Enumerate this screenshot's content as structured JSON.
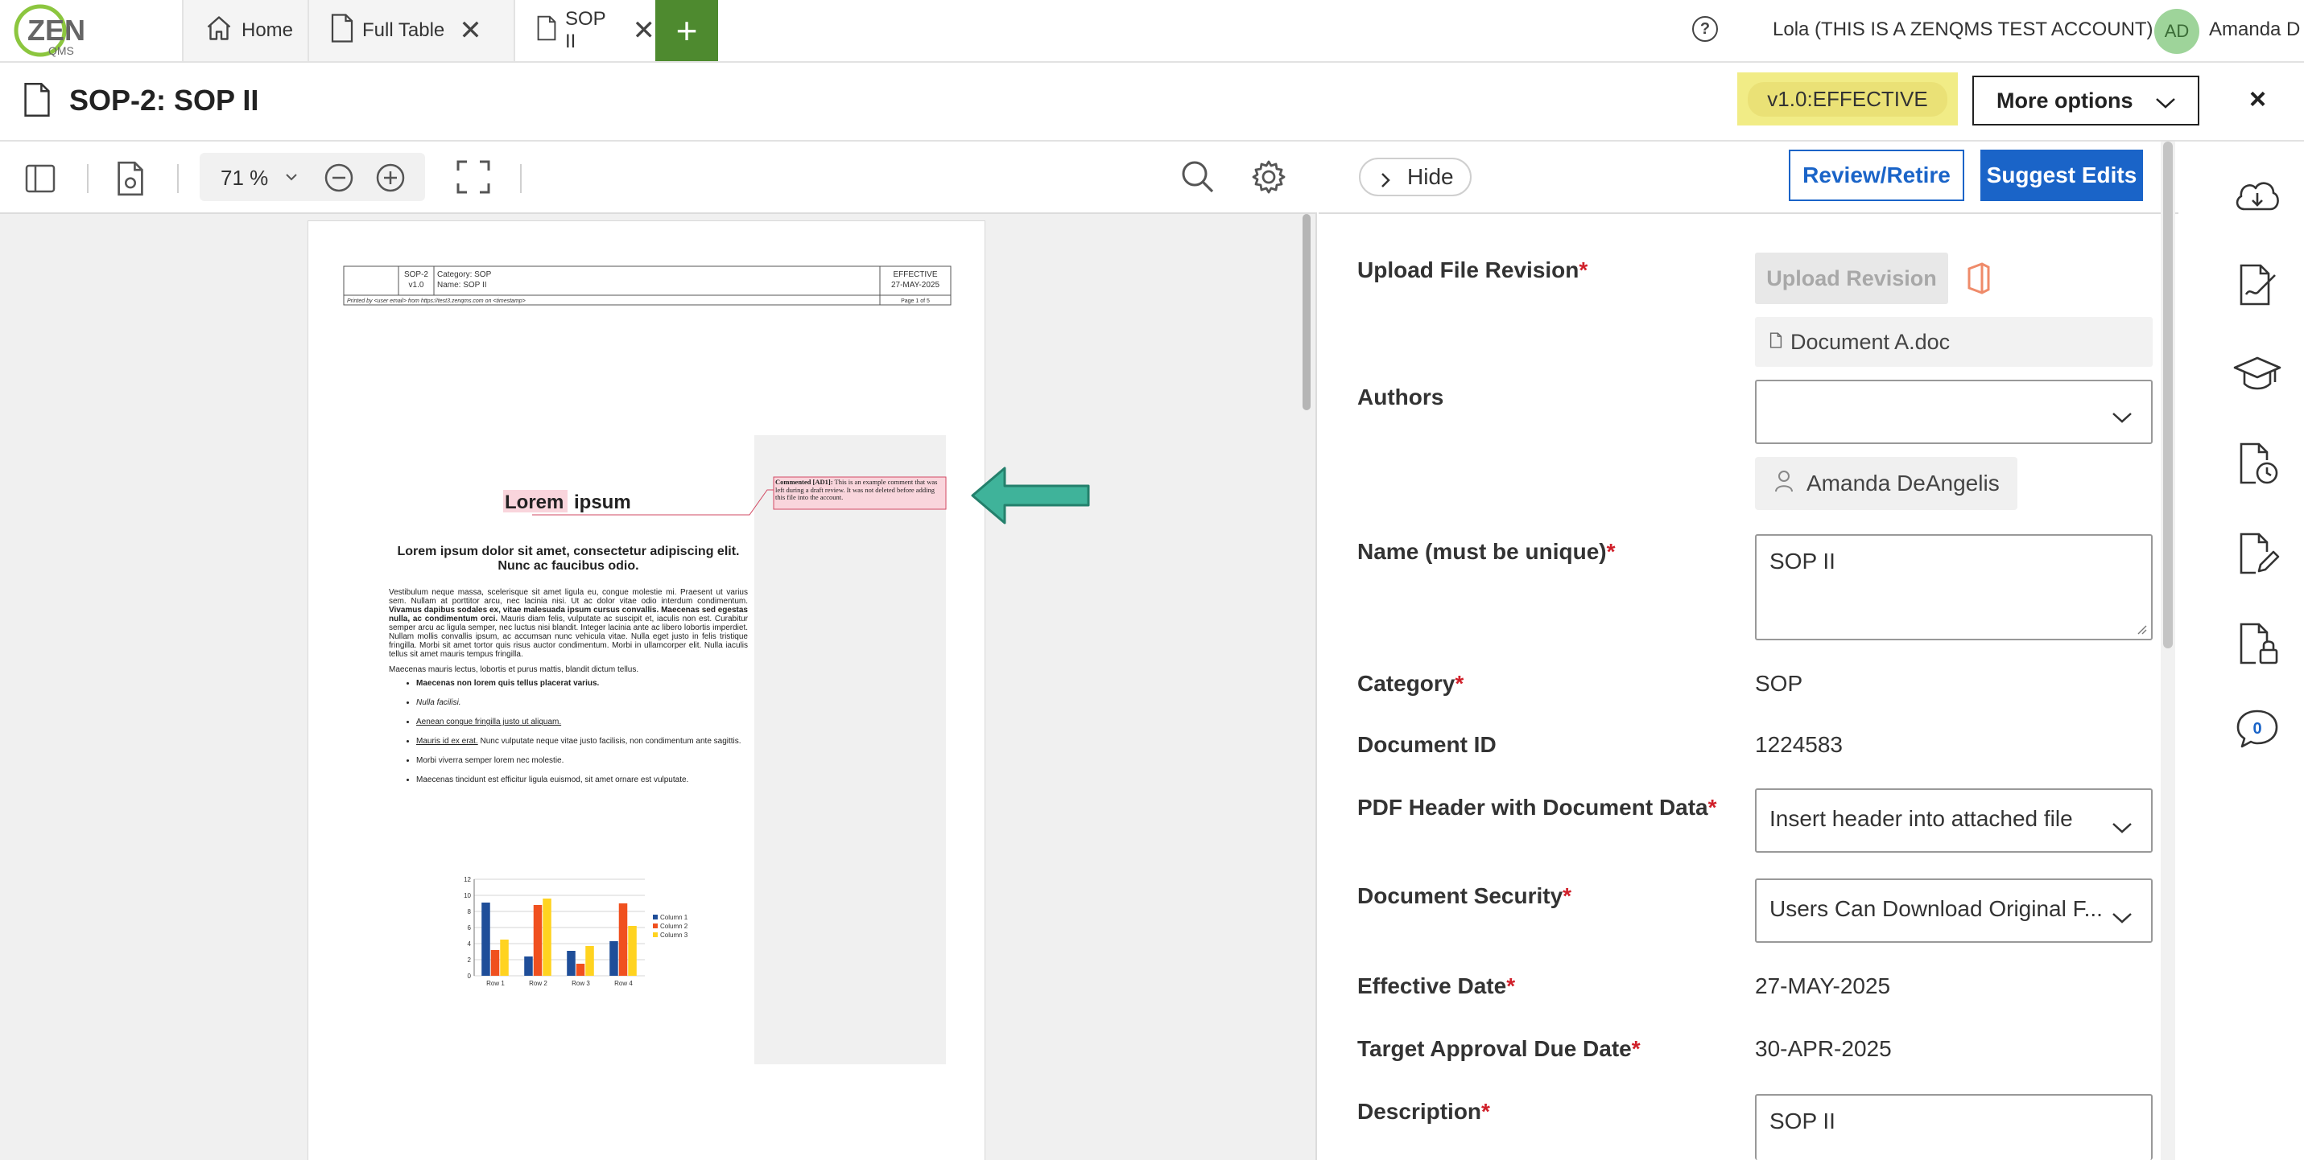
{
  "topbar": {
    "tabs": [
      {
        "label": "Home",
        "icon": "home-icon"
      },
      {
        "label": "Full Table",
        "icon": "document-icon"
      },
      {
        "label": "SOP II",
        "icon": "document-icon",
        "active": true
      }
    ],
    "add_tab_label": "+",
    "help_label": "?",
    "account_label": "Lola (THIS IS A ZENQMS TEST ACCOUNT)",
    "avatar_initials": "AD",
    "user_name": "Amanda D"
  },
  "logo": {
    "text": "ZEN",
    "subtext": "QMS"
  },
  "doc_header": {
    "title": "SOP-2: SOP II",
    "status": "v1.0:EFFECTIVE",
    "more_options_label": "More options",
    "close_label": "×"
  },
  "viewer_toolbar": {
    "zoom": "71 %"
  },
  "pdf": {
    "header": {
      "doc_id": "SOP-2",
      "version": "v1.0",
      "category": "Category: SOP",
      "name": "Name: SOP II",
      "status": "EFFECTIVE",
      "date": "27-MAY-2025",
      "printed_by": "Printed by <user email> from https://test3.zenqms.com on <timestamp>",
      "page": "Page 1 of 5"
    },
    "heading_word1": "Lorem",
    "heading_word2": "ipsum",
    "comment_label": "Commented [AD1]:",
    "comment_text": "This is an example comment that was left during a draft review. It was not deleted before adding this file into the account.",
    "subheading": "Lorem ipsum dolor sit amet, consectetur adipiscing elit. Nunc ac faucibus odio.",
    "paragraph1_a": "Vestibulum neque massa, scelerisque sit amet ligula eu, congue molestie mi. Praesent ut varius sem. Nullam at porttitor arcu, nec lacinia nisi. Ut ac dolor vitae odio interdum condimentum.",
    "paragraph1_b": "Vivamus dapibus sodales ex, vitae malesuada ipsum cursus convallis. Maecenas sed egestas nulla, ac condimentum orci.",
    "paragraph1_c": "Mauris diam felis, vulputate ac suscipit et, iaculis non est. Curabitur semper arcu ac ligula semper, nec luctus nisi blandit. Integer lacinia ante ac libero lobortis imperdiet. Nullam mollis convallis ipsum, ac accumsan nunc vehicula vitae. Nulla eget justo in felis tristique fringilla. Morbi sit amet tortor quis risus auctor condimentum. Morbi in ullamcorper elit. Nulla iaculis tellus sit amet mauris tempus fringilla.",
    "paragraph2": "Maecenas mauris lectus, lobortis et purus mattis, blandit dictum tellus.",
    "bullets": [
      "Maecenas non lorem quis tellus placerat varius.",
      "Nulla facilisi.",
      "Aenean congue fringilla justo ut aliquam.",
      "Mauris id ex erat. Nunc vulputate neque vitae justo facilisis, non condimentum ante sagittis.",
      "Morbi viverra semper lorem nec molestie.",
      "Maecenas tincidunt est efficitur ligula euismod, sit amet ornare est vulputate."
    ],
    "bullet4_link": "Mauris id ex erat.",
    "bullet4_rest": " Nunc vulputate neque vitae justo facilisis, non condimentum ante sagittis."
  },
  "chart_data": {
    "type": "bar",
    "categories": [
      "Row 1",
      "Row 2",
      "Row 3",
      "Row 4"
    ],
    "series": [
      {
        "name": "Column 1",
        "values": [
          9.1,
          2.4,
          3.1,
          4.3
        ],
        "color": "#1f4e99"
      },
      {
        "name": "Column 2",
        "values": [
          3.2,
          8.8,
          1.5,
          9.0
        ],
        "color": "#f0501f"
      },
      {
        "name": "Column 3",
        "values": [
          4.5,
          9.6,
          3.7,
          6.2
        ],
        "color": "#ffd320"
      }
    ],
    "yticks": [
      "0",
      "2",
      "4",
      "6",
      "8",
      "10",
      "12"
    ],
    "ylim": [
      0,
      12
    ],
    "grid": true,
    "legend": "right"
  },
  "panel": {
    "hide_label": "Hide",
    "review_label": "Review/Retire",
    "suggest_label": "Suggest Edits",
    "upload_label": "Upload File Revision",
    "upload_button": "Upload Revision",
    "file_name": "Document A.doc",
    "authors_label": "Authors",
    "author_chip": "Amanda DeAngelis",
    "name_label": "Name (must be unique)",
    "name_value": "SOP II",
    "category_label": "Category",
    "category_value": "SOP",
    "doc_id_label": "Document ID",
    "doc_id_value": "1224583",
    "pdf_header_label": "PDF Header with Document Data",
    "pdf_header_value": "Insert header into attached file",
    "security_label": "Document Security",
    "security_value": "Users Can Download Original F...",
    "effective_label": "Effective Date",
    "effective_value": "27-MAY-2025",
    "target_label": "Target Approval Due Date",
    "target_value": "30-APR-2025",
    "description_label": "Description",
    "description_value": "SOP II",
    "required_mark": "*"
  },
  "rail": {
    "comment_count": "0",
    "items": [
      "cloud-download-icon",
      "signature-icon",
      "training-cap-icon",
      "history-icon",
      "edit-document-icon",
      "lock-document-icon",
      "comment-icon"
    ]
  },
  "colors": {
    "accent_blue": "#1a64c8",
    "tab_add_green": "#4e8a2f",
    "status_highlight": "#f1ec86",
    "arrow_teal": "#3fb39a",
    "required_red": "#d0202a"
  }
}
